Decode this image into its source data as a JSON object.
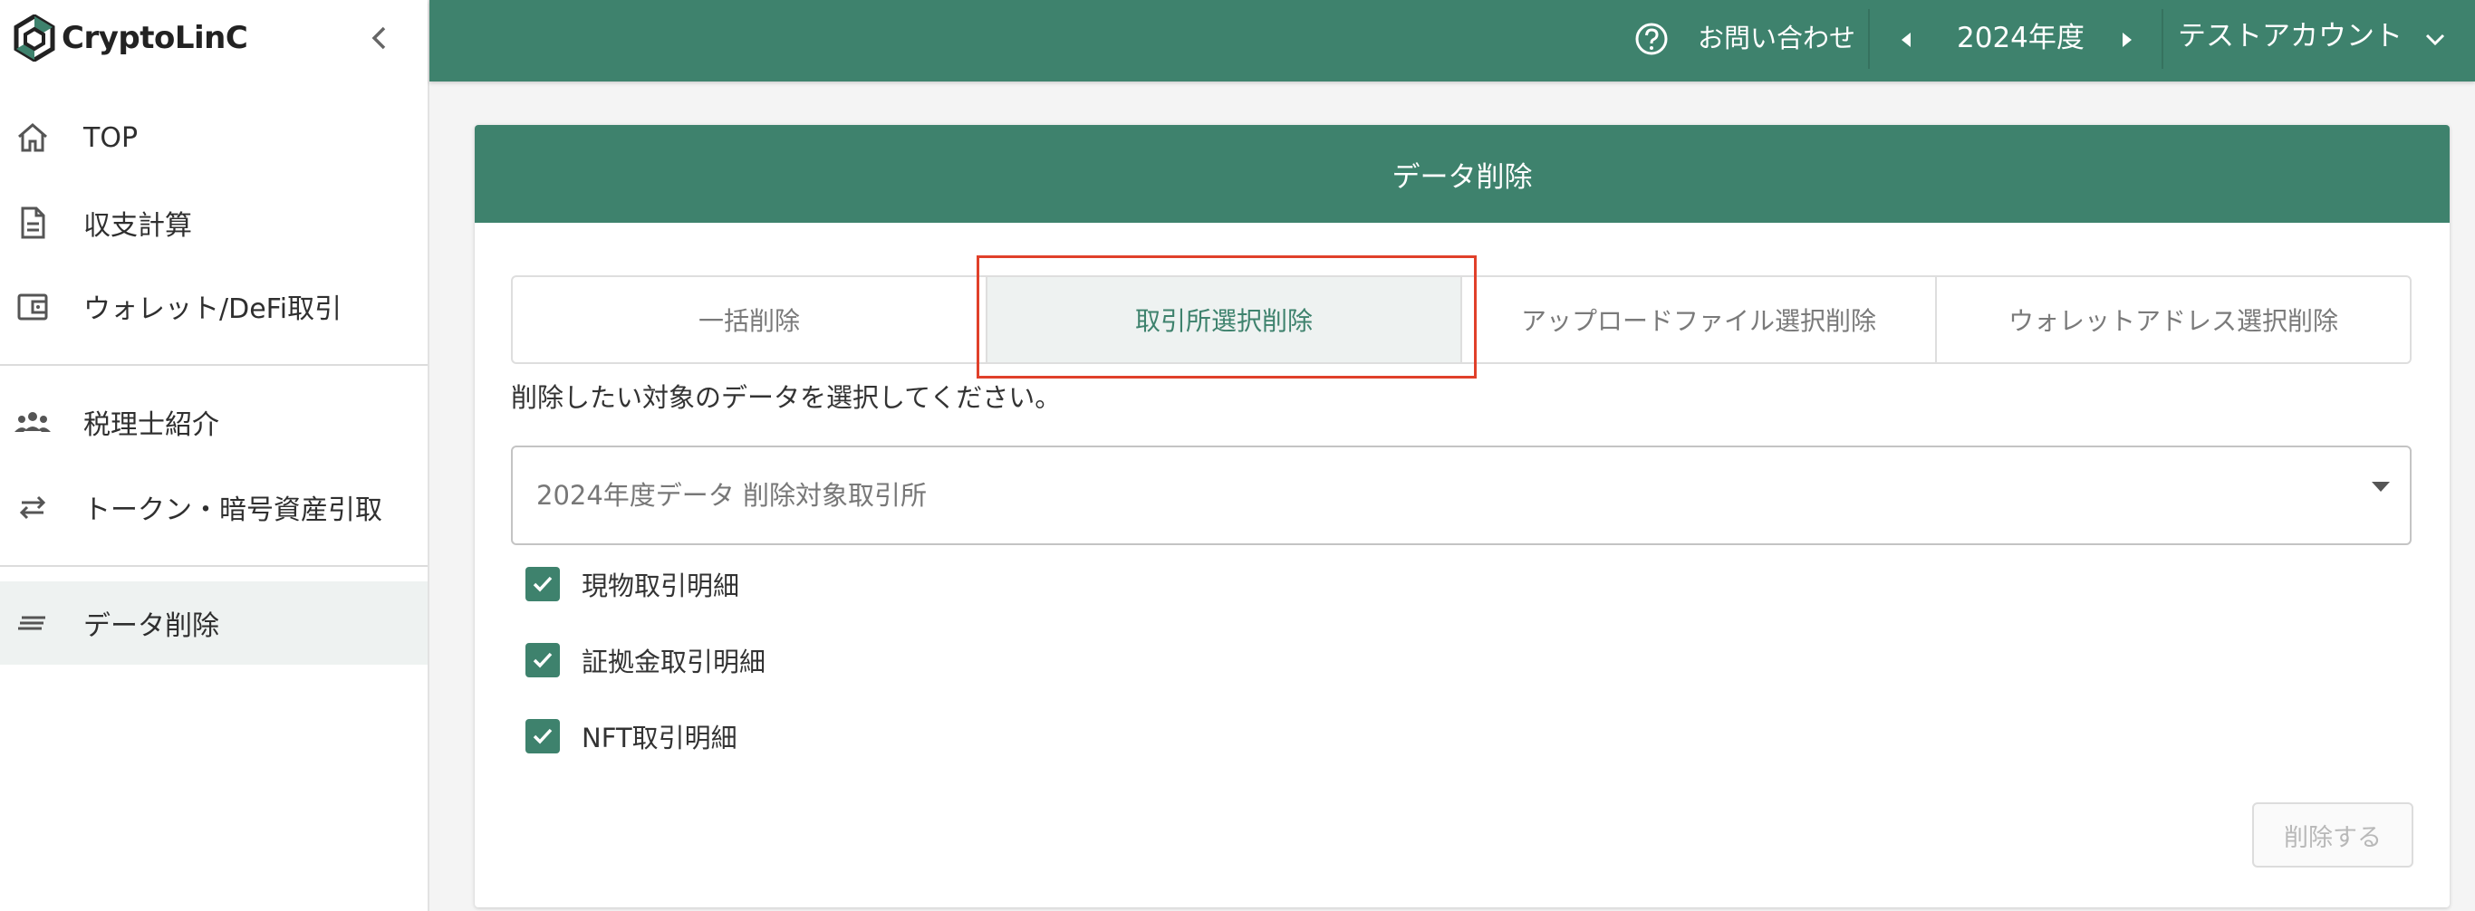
{
  "brand": {
    "name": "CryptoLinC"
  },
  "sidebar": {
    "items": [
      {
        "label": "TOP",
        "icon": "home-icon"
      },
      {
        "label": "収支計算",
        "icon": "document-icon"
      },
      {
        "label": "ウォレット/DeFi取引",
        "icon": "wallet-icon"
      },
      {
        "label": "税理士紹介",
        "icon": "people-icon"
      },
      {
        "label": "トークン・暗号資産引取",
        "icon": "swap-icon"
      },
      {
        "label": "データ削除",
        "icon": "lines-icon",
        "active": true
      }
    ]
  },
  "header": {
    "contact_label": "お問い合わせ",
    "year_label": "2024年度",
    "account_label": "テストアカウント"
  },
  "card": {
    "title": "データ削除",
    "tabs": [
      {
        "label": "一括削除"
      },
      {
        "label": "取引所選択削除",
        "active": true
      },
      {
        "label": "アップロードファイル選択削除"
      },
      {
        "label": "ウォレットアドレス選択削除"
      }
    ],
    "instruction": "削除したい対象のデータを選択してください。",
    "select": {
      "placeholder": "2024年度データ 削除対象取引所"
    },
    "checkboxes": [
      {
        "label": "現物取引明細",
        "checked": true
      },
      {
        "label": "証拠金取引明細",
        "checked": true
      },
      {
        "label": "NFT取引明細",
        "checked": true
      }
    ],
    "delete_button": "削除する"
  },
  "colors": {
    "primary": "#3e826d",
    "highlight": "#e0402a",
    "active_bg": "#eef2f1"
  }
}
